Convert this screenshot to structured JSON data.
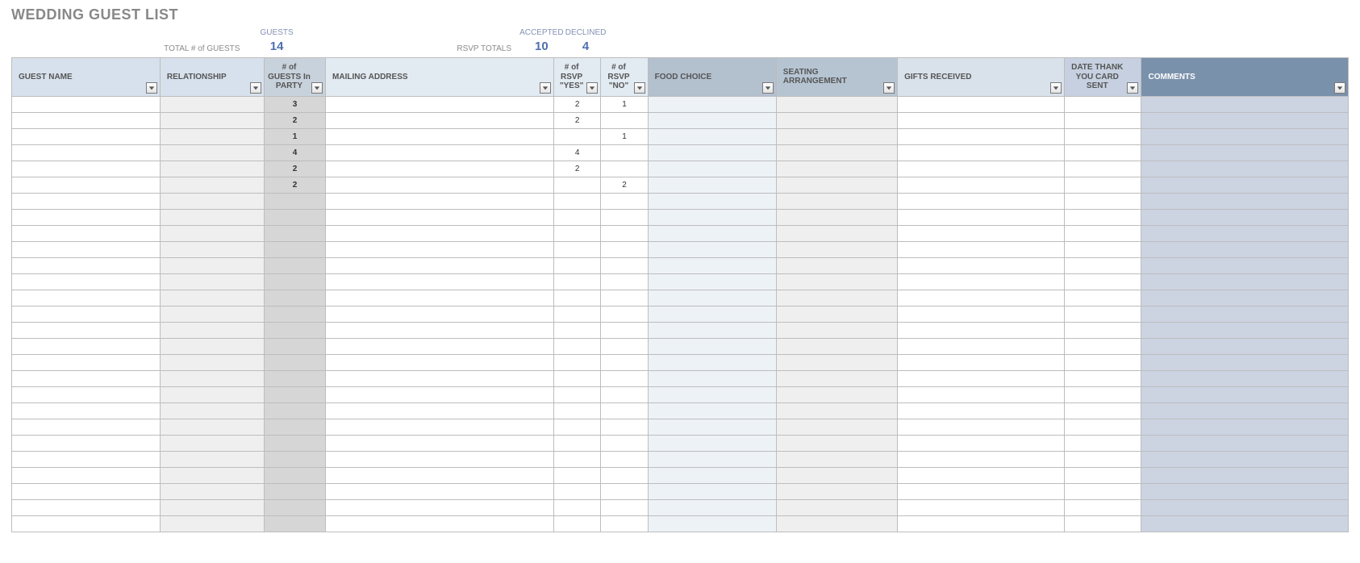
{
  "title": "WEDDING GUEST LIST",
  "totals": {
    "total_label": "TOTAL # of GUESTS",
    "guests_label": "GUESTS",
    "guests_value": "14",
    "rsvp_label": "RSVP TOTALS",
    "accepted_label": "ACCEPTED",
    "accepted_value": "10",
    "declined_label": "DECLINED",
    "declined_value": "4"
  },
  "headers": {
    "guest_name": "GUEST NAME",
    "relationship": "RELATIONSHIP",
    "num_in_party": "# of GUESTS In PARTY",
    "mailing_address": "MAILING ADDRESS",
    "rsvp_yes": "# of RSVP \"YES\"",
    "rsvp_no": "# of RSVP \"NO\"",
    "food_choice": "FOOD CHOICE",
    "seating": "SEATING ARRANGEMENT",
    "gifts": "GIFTS RECEIVED",
    "thank_you": "DATE THANK YOU CARD SENT",
    "comments": "COMMENTS"
  },
  "rows": [
    {
      "party": "3",
      "yes": "2",
      "no": "1"
    },
    {
      "party": "2",
      "yes": "2",
      "no": ""
    },
    {
      "party": "1",
      "yes": "",
      "no": "1"
    },
    {
      "party": "4",
      "yes": "4",
      "no": ""
    },
    {
      "party": "2",
      "yes": "2",
      "no": ""
    },
    {
      "party": "2",
      "yes": "",
      "no": "2"
    },
    {
      "party": "",
      "yes": "",
      "no": ""
    },
    {
      "party": "",
      "yes": "",
      "no": ""
    },
    {
      "party": "",
      "yes": "",
      "no": ""
    },
    {
      "party": "",
      "yes": "",
      "no": ""
    },
    {
      "party": "",
      "yes": "",
      "no": ""
    },
    {
      "party": "",
      "yes": "",
      "no": ""
    },
    {
      "party": "",
      "yes": "",
      "no": ""
    },
    {
      "party": "",
      "yes": "",
      "no": ""
    },
    {
      "party": "",
      "yes": "",
      "no": ""
    },
    {
      "party": "",
      "yes": "",
      "no": ""
    },
    {
      "party": "",
      "yes": "",
      "no": ""
    },
    {
      "party": "",
      "yes": "",
      "no": ""
    },
    {
      "party": "",
      "yes": "",
      "no": ""
    },
    {
      "party": "",
      "yes": "",
      "no": ""
    },
    {
      "party": "",
      "yes": "",
      "no": ""
    },
    {
      "party": "",
      "yes": "",
      "no": ""
    },
    {
      "party": "",
      "yes": "",
      "no": ""
    },
    {
      "party": "",
      "yes": "",
      "no": ""
    },
    {
      "party": "",
      "yes": "",
      "no": ""
    },
    {
      "party": "",
      "yes": "",
      "no": ""
    },
    {
      "party": "",
      "yes": "",
      "no": ""
    }
  ]
}
